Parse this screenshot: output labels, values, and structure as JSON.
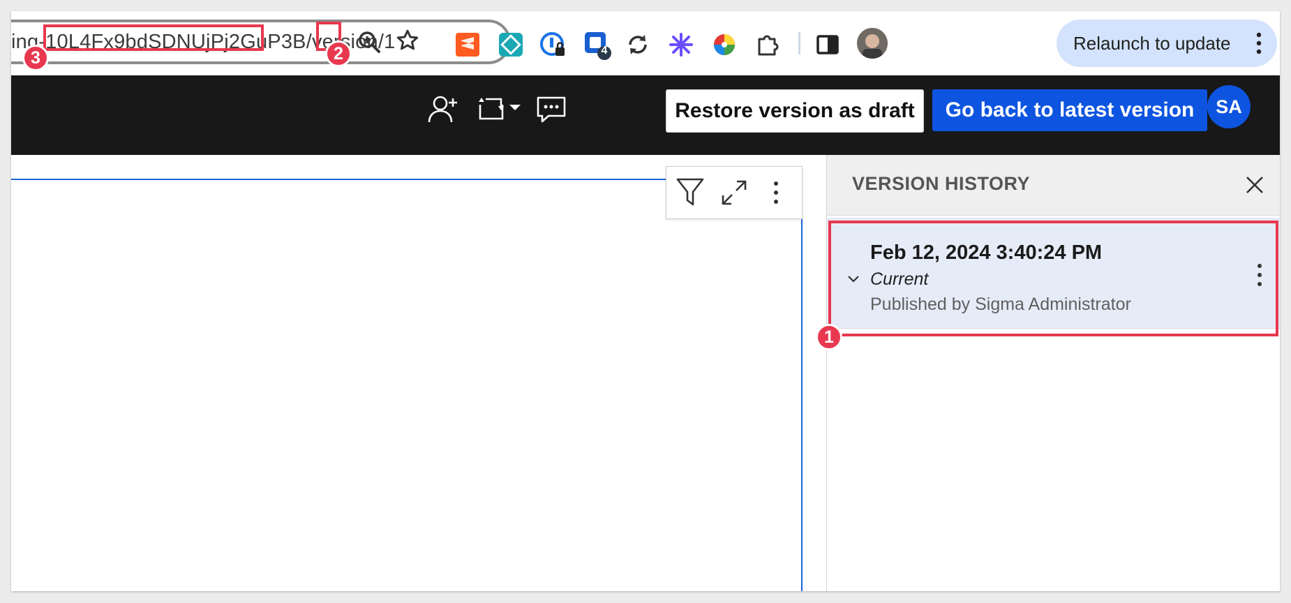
{
  "browser": {
    "url_parts": {
      "prefix": "ing-",
      "doc_id": "10L4Fx9bdSDNUjPj2GuP3B",
      "path": "/version",
      "version_num": "/1"
    },
    "relaunch_label": "Relaunch to update",
    "extension_badge": "4"
  },
  "annotations": {
    "m1": "1",
    "m2": "2",
    "m3": "3"
  },
  "header": {
    "restore_label": "Restore version as draft",
    "latest_label": "Go back to latest version",
    "avatar_initials": "SA"
  },
  "version_history": {
    "title": "VERSION HISTORY",
    "entries": [
      {
        "date": "Feb 12, 2024 3:40:24 PM",
        "status": "Current",
        "published_by": "Published by Sigma Administrator"
      }
    ]
  },
  "colors": {
    "accent": "#0d55e0",
    "annotation": "#e8384f",
    "header_bg": "#181818",
    "selected_bg": "#e6ebf8"
  }
}
